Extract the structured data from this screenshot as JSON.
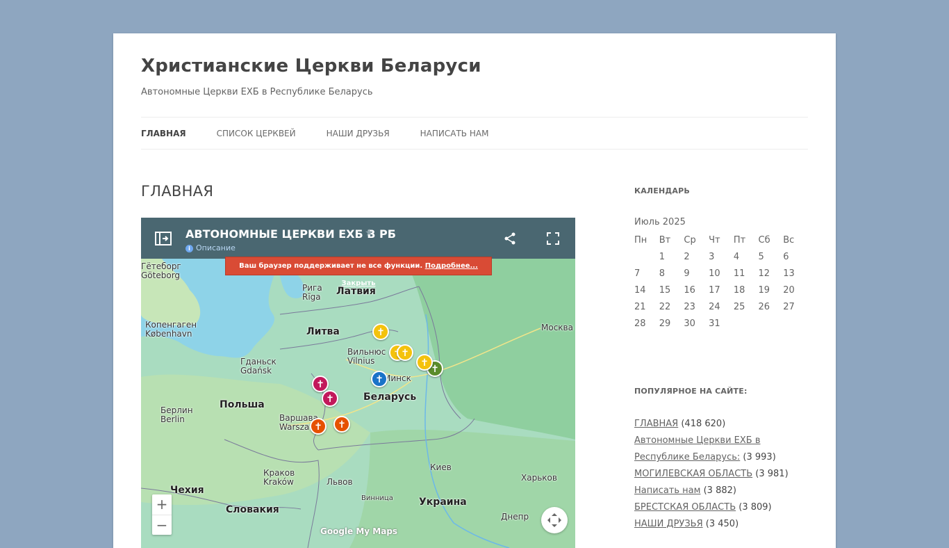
{
  "site": {
    "title": "Христианские Церкви Беларуси",
    "description": "Автономные Церкви ЕХБ в Республике Беларусь"
  },
  "nav": [
    {
      "label": "ГЛАВНАЯ",
      "current": true
    },
    {
      "label": "СПИСОК ЦЕРКВЕЙ",
      "current": false
    },
    {
      "label": "НАШИ ДРУЗЬЯ",
      "current": false
    },
    {
      "label": "НАПИСАТЬ НАМ",
      "current": false
    }
  ],
  "page_title": "ГЛАВНАЯ",
  "map": {
    "title": "АВТОНОМНЫЕ ЦЕРКВИ ЕХБ В РБ",
    "description": "Описание",
    "warning_text": "Ваш браузер поддерживает не все функции.",
    "warning_more": "Подробнее...",
    "warning_close": "Закрыть",
    "zoom_in": "+",
    "zoom_out": "−",
    "attribution": "Google My Maps",
    "places": [
      {
        "name": "Гётеборг",
        "alt": "Göteborg"
      },
      {
        "name": "Рига",
        "alt": "Rīga"
      },
      {
        "name": "Латвия"
      },
      {
        "name": "Копенгаген",
        "alt": "København"
      },
      {
        "name": "Литва"
      },
      {
        "name": "Вильнюс",
        "alt": "Vilnius"
      },
      {
        "name": "Москва"
      },
      {
        "name": "Гданьск",
        "alt": "Gdańsk"
      },
      {
        "name": "Минск"
      },
      {
        "name": "Беларусь"
      },
      {
        "name": "Польша"
      },
      {
        "name": "Берлин",
        "alt": "Berlin"
      },
      {
        "name": "Варшава",
        "alt": "Warszawa"
      },
      {
        "name": "Киев"
      },
      {
        "name": "Краков",
        "alt": "Kraków"
      },
      {
        "name": "Львов"
      },
      {
        "name": "Харьков"
      },
      {
        "name": "Чехия"
      },
      {
        "name": "Винница"
      },
      {
        "name": "Словакия"
      },
      {
        "name": "Украина"
      },
      {
        "name": "Днепр"
      }
    ],
    "pin_colors": {
      "yellow": "#f4c20d",
      "green": "#5b8c2a",
      "blue": "#1a73c8",
      "magenta": "#c2185b",
      "orange": "#e65100"
    }
  },
  "sidebar": {
    "calendar_title": "КАЛЕНДАРЬ",
    "month": "Июль 2025",
    "weekdays": [
      "Пн",
      "Вт",
      "Ср",
      "Чт",
      "Пт",
      "Сб",
      "Вс"
    ],
    "weeks": [
      [
        "",
        "1",
        "2",
        "3",
        "4",
        "5",
        "6"
      ],
      [
        "7",
        "8",
        "9",
        "10",
        "11",
        "12",
        "13"
      ],
      [
        "14",
        "15",
        "16",
        "17",
        "18",
        "19",
        "20"
      ],
      [
        "21",
        "22",
        "23",
        "24",
        "25",
        "26",
        "27"
      ],
      [
        "28",
        "29",
        "30",
        "31",
        "",
        "",
        ""
      ]
    ],
    "popular_title": "ПОПУЛЯРНОЕ НА САЙТЕ:",
    "popular": [
      {
        "label": "ГЛАВНАЯ",
        "count": "(418 620)"
      },
      {
        "label": "Автономные Церкви ЕХБ в Республике Беларусь:",
        "count": "(3 993)"
      },
      {
        "label": "МОГИЛЕВСКАЯ ОБЛАСТЬ",
        "count": "(3 981)"
      },
      {
        "label": "Написать нам",
        "count": "(3 882)"
      },
      {
        "label": "БРЕСТСКАЯ ОБЛАСТЬ",
        "count": "(3 809)"
      },
      {
        "label": "НАШИ ДРУЗЬЯ",
        "count": "(3 450)"
      }
    ]
  }
}
